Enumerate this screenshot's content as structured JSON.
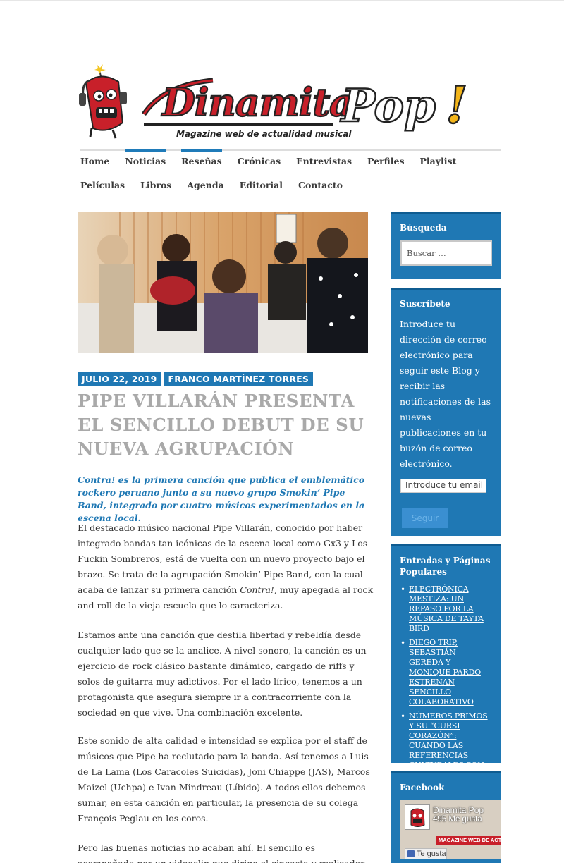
{
  "site": {
    "logo_text_main": "Dinamita Pop!",
    "logo_tagline": "Magazine web de actualidad musical"
  },
  "nav": {
    "items": [
      {
        "label": "Home",
        "active": false
      },
      {
        "label": "Noticias",
        "active": true
      },
      {
        "label": "Reseñas",
        "active": true
      },
      {
        "label": "Crónicas",
        "active": false
      },
      {
        "label": "Entrevistas",
        "active": false
      },
      {
        "label": "Perfiles",
        "active": false
      },
      {
        "label": "Playlist",
        "active": false
      },
      {
        "label": "Películas",
        "active": false
      },
      {
        "label": "Libros",
        "active": false
      },
      {
        "label": "Agenda",
        "active": false
      },
      {
        "label": "Editorial",
        "active": false
      },
      {
        "label": "Contacto",
        "active": false
      }
    ]
  },
  "post": {
    "date": "JULIO 22, 2019",
    "author": "FRANCO MARTÍNEZ TORRES",
    "title": "PIPE VILLARÁN PRESENTA EL SENCILLO DEBUT DE SU NUEVA AGRUPACIÓN",
    "lede": {
      "song": "Contra!",
      "rest": " es la primera canción que publica el emblemático rockero peruano junto a su nuevo grupo Smokin‘ Pipe Band, integrado por cuatro músicos experimentados en la escena local."
    },
    "p1": {
      "before": "El destacado músico nacional Pipe Villarán, conocido por haber integrado bandas tan icónicas de la escena local como Gx3 y Los Fuckin Sombreros, está de vuelta con un nuevo proyecto bajo el brazo. Se trata de la agrupación Smokin’ Pipe Band, con la cual acaba de lanzar su primera canción ",
      "song": "Contra!",
      "after": ", muy apegada al rock and roll de la vieja escuela que lo caracteriza."
    },
    "p2": "Estamos ante una canción que destila libertad y rebeldía desde cualquier lado que se la analice. A nivel sonoro, la canción es un ejercicio de rock clásico bastante dinámico, cargado de riffs y solos de guitarra muy adictivos. Por el lado lírico, tenemos a un protagonista que asegura siempre ir a contracorriente con la sociedad en que vive. Una combinación excelente.",
    "p3": "Este sonido de alta calidad e intensidad se explica por el staff de músicos que Pipe ha reclutado para la banda. Así tenemos a Luis de La Lama (Los Caracoles Suicidas), Joni Chiappe (JAS), Marcos Maizel (Uchpa) e Ivan Mindreau (Líbido). A todos ellos debemos sumar, en esta canción en particular, la presencia de su colega François Peglau en los coros.",
    "p4": "Pero las buenas noticias no acaban ahí. El sencillo es acompañado por un videoclip que dirige el cineasta y realizador peruano Franco"
  },
  "sidebar": {
    "search": {
      "title": "Búsqueda",
      "placeholder": "Buscar …"
    },
    "subscribe": {
      "title": "Suscríbete",
      "text": "Introduce tu dirección de correo electrónico para seguir este Blog y recibir las notificaciones de las nuevas publicaciones en tu buzón de correo electrónico.",
      "email_placeholder": "Introduce tu email",
      "button": "Seguir"
    },
    "popular": {
      "title": "Entradas y Páginas Populares",
      "items": [
        "ELECTRÓNICA MESTIZA: UN REPASO POR LA MÚSICA DE TAYTA BIRD",
        "DIEGO TRIP, SEBASTIÁN GEREDA Y MONIQUE PARDO ESTRENAN SENCILLO COLABORATIVO",
        "NÚMEROS PRIMOS Y SU “CURSI CORAZÓN”: CUANDO LAS REFERENCIAS CULTURALES SON UN ARMA DE DOBLE FILO"
      ]
    },
    "facebook": {
      "title": "Facebook",
      "page_name": "Dinamita Pop",
      "likes": "495 Me gusta",
      "banner": "MAGAZINE WEB DE ACTUALI",
      "like_button": "Te gusta"
    }
  },
  "colors": {
    "accent": "#1f78b4",
    "logo_red": "#c8202a",
    "title_gray": "#a9a9a9"
  }
}
